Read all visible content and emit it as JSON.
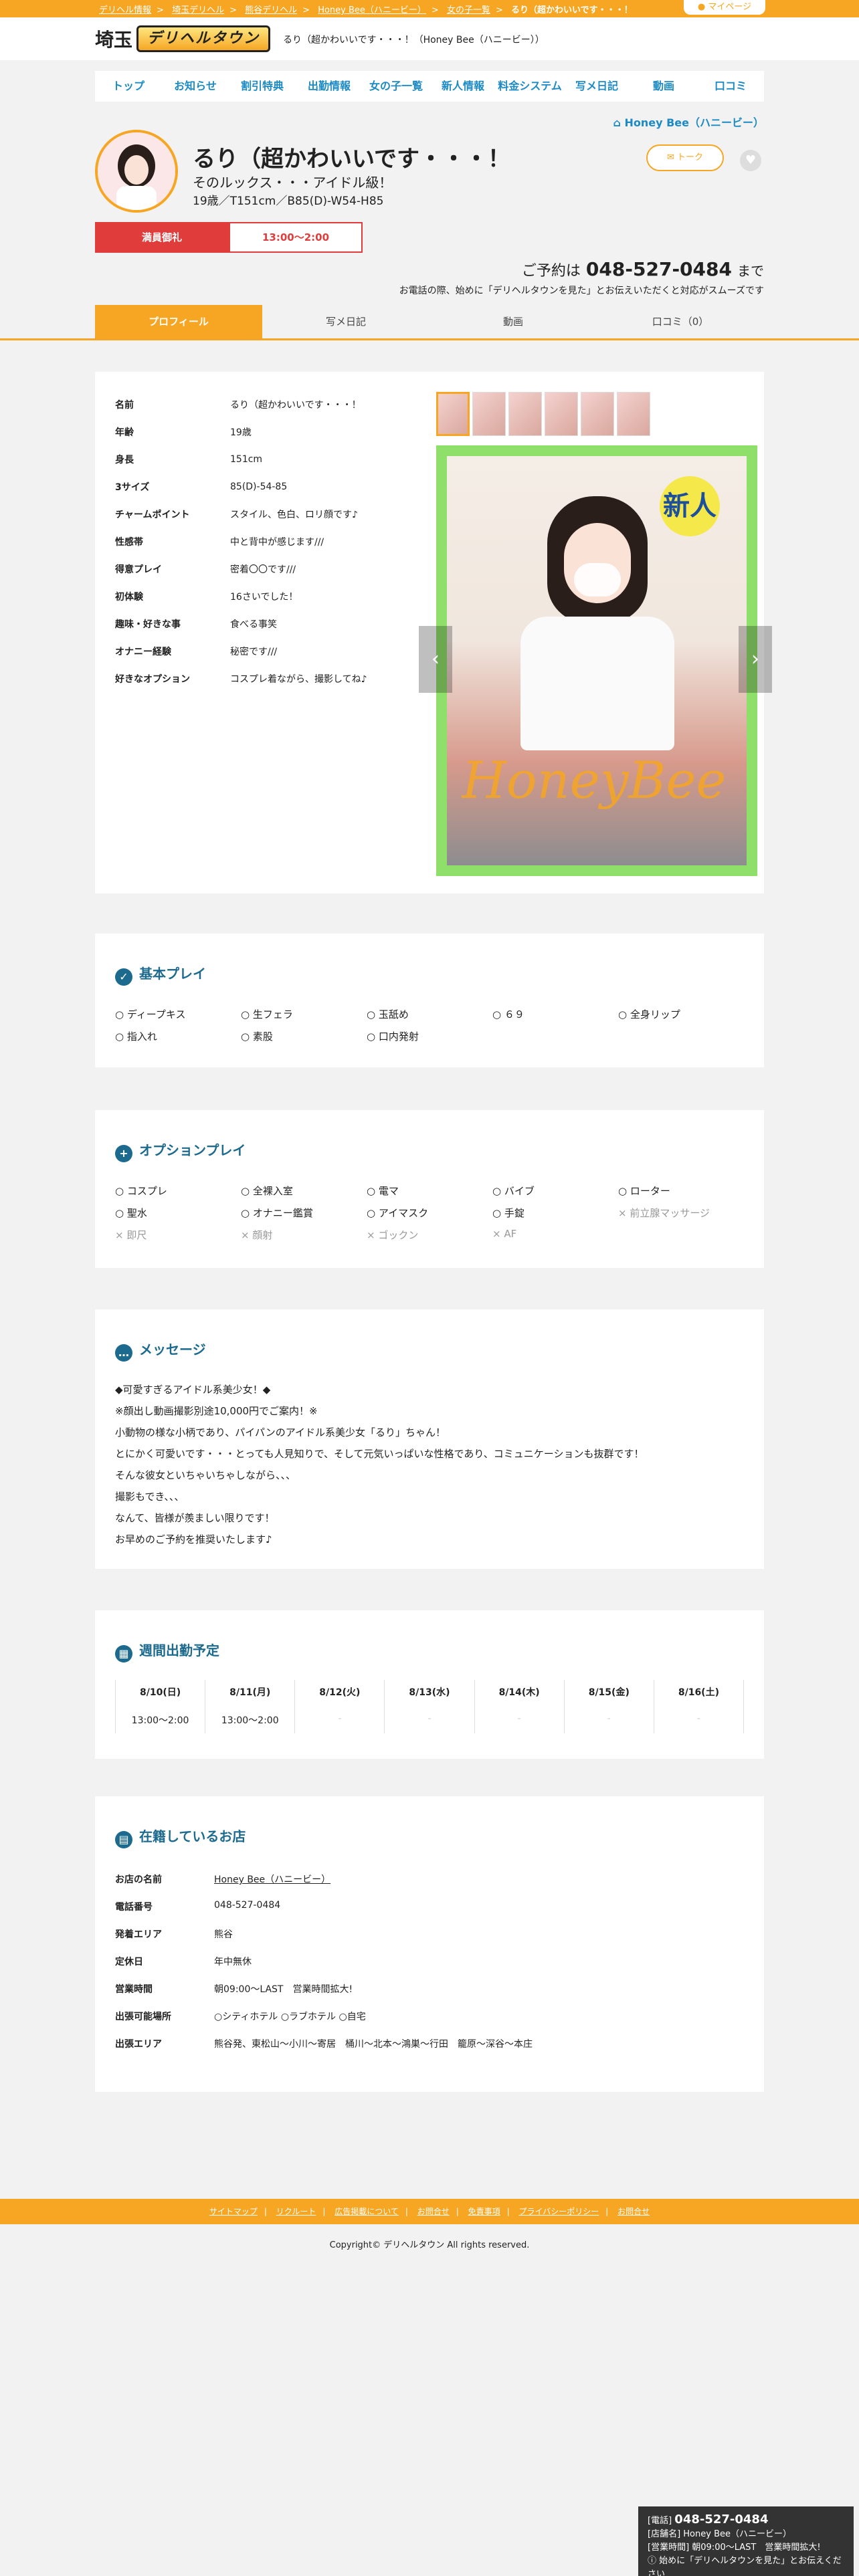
{
  "breadcrumbs": [
    "デリヘル情報",
    "埼玉デリヘル",
    "熊谷デリヘル",
    "Honey Bee（ハニービー）",
    "女の子一覧",
    "るり（超かわいいです・・・！"
  ],
  "mypage_label": "マイページ",
  "logo": {
    "area": "埼玉",
    "brand": "デリヘルタウン"
  },
  "tagline": "るり（超かわいいです・・・！（Honey Bee（ハニービー））",
  "nav": [
    "トップ",
    "お知らせ",
    "割引特典",
    "出勤情報",
    "女の子一覧",
    "新人情報",
    "料金システム",
    "写メ日記",
    "動画",
    "口コミ"
  ],
  "shop_link": "Honey Bee（ハニービー）",
  "profile": {
    "name": "るり（超かわいいです・・・！",
    "catch": "そのルックス・・・アイドル級！",
    "spec": "19歳／T151cm／B85(D)-W54-H85",
    "talk_label": "トーク",
    "badge_status": "満員御礼",
    "badge_time": "13:00〜2:00"
  },
  "reservation": {
    "label": "ご予約は",
    "tel": "048-527-0484",
    "suffix": "まで",
    "note": "お電話の際、始めに「デリヘルタウンを見た」とお伝えいただくと対応がスムーズです"
  },
  "tabs": [
    "プロフィール",
    "写メ日記",
    "動画",
    "口コミ（0）"
  ],
  "profile_table": [
    {
      "k": "名前",
      "v": "るり（超かわいいです・・・！"
    },
    {
      "k": "年齢",
      "v": "19歳"
    },
    {
      "k": "身長",
      "v": "151cm"
    },
    {
      "k": "3サイズ",
      "v": "85(D)-54-85"
    },
    {
      "k": "チャームポイント",
      "v": "スタイル、色白、ロリ顔です♪"
    },
    {
      "k": "性感帯",
      "v": "中と背中が感じます///"
    },
    {
      "k": "得意プレイ",
      "v": "密着〇〇です///"
    },
    {
      "k": "初体験",
      "v": "16さいでした！"
    },
    {
      "k": "趣味・好きな事",
      "v": "食べる事笑"
    },
    {
      "k": "オナニー経験",
      "v": "秘密です///"
    },
    {
      "k": "好きなオプション",
      "v": "コスプレ着ながら、撮影してね♪"
    }
  ],
  "photo": {
    "new_label": "新人",
    "watermark": "HoneyBee"
  },
  "basic_play": {
    "title": "基本プレイ",
    "items": [
      "ディープキス",
      "生フェラ",
      "玉舐め",
      "６９",
      "全身リップ",
      "指入れ",
      "素股",
      "口内発射"
    ]
  },
  "option_play": {
    "title": "オプションプレイ",
    "items": [
      {
        "label": "コスプレ",
        "ok": true
      },
      {
        "label": "全裸入室",
        "ok": true
      },
      {
        "label": "電マ",
        "ok": true
      },
      {
        "label": "バイブ",
        "ok": true
      },
      {
        "label": "ローター",
        "ok": true
      },
      {
        "label": "聖水",
        "ok": true
      },
      {
        "label": "オナニー鑑賞",
        "ok": true
      },
      {
        "label": "アイマスク",
        "ok": true
      },
      {
        "label": "手錠",
        "ok": true
      },
      {
        "label": "前立腺マッサージ",
        "ok": false
      },
      {
        "label": "即尺",
        "ok": false
      },
      {
        "label": "顔射",
        "ok": false
      },
      {
        "label": "ゴックン",
        "ok": false
      },
      {
        "label": "AF",
        "ok": false
      }
    ]
  },
  "message": {
    "title": "メッセージ",
    "lines": [
      "◆可愛すぎるアイドル系美少女！◆",
      "※顔出し動画撮影別途10,000円でご案内！※",
      "小動物の様な小柄であり、パイパンのアイドル系美少女「るり」ちゃん！",
      "とにかく可愛いです・・・とっても人見知りで、そして元気いっぱいな性格であり、コミュニケーションも抜群です！",
      "そんな彼女といちゃいちゃしながら、、、",
      "撮影もでき、、、",
      "なんて、皆様が羨ましい限りです！",
      "お早めのご予約を推奨いたします♪"
    ]
  },
  "schedule": {
    "title": "週間出勤予定",
    "days": [
      {
        "d": "8/10(日)",
        "t": "13:00〜2:00"
      },
      {
        "d": "8/11(月)",
        "t": "13:00〜2:00"
      },
      {
        "d": "8/12(火)",
        "t": "-"
      },
      {
        "d": "8/13(水)",
        "t": "-"
      },
      {
        "d": "8/14(木)",
        "t": "-"
      },
      {
        "d": "8/15(金)",
        "t": "-"
      },
      {
        "d": "8/16(土)",
        "t": "-"
      }
    ]
  },
  "shop": {
    "title": "在籍しているお店",
    "rows": [
      {
        "k": "お店の名前",
        "v": "Honey Bee（ハニービー）"
      },
      {
        "k": "電話番号",
        "v": "048-527-0484"
      },
      {
        "k": "発着エリア",
        "v": "熊谷"
      },
      {
        "k": "定休日",
        "v": "年中無休"
      },
      {
        "k": "営業時間",
        "v": "朝09:00〜LAST　営業時間拡大!"
      },
      {
        "k": "出張可能場所",
        "v": "○シティホテル ○ラブホテル ○自宅"
      },
      {
        "k": "出張エリア",
        "v": "熊谷発、東松山〜小川〜寄居　桶川〜北本〜鴻巣〜行田　籠原〜深谷〜本庄"
      }
    ]
  },
  "footer_links": [
    "サイトマップ",
    "リクルート",
    "広告掲載について",
    "お問合せ",
    "免責事項",
    "プライバシーポリシー",
    "お問合せ"
  ],
  "copyright": "Copyright© デリヘルタウン All rights reserved.",
  "float_box": {
    "tel_label": "[電話]",
    "tel": "048-527-0484",
    "shop": "[店舗名] Honey Bee（ハニービー）",
    "hours": "[営業時間] 朝09:00〜LAST　営業時間拡大!",
    "note": "始めに「デリヘルタウンを見た」とお伝えください"
  }
}
